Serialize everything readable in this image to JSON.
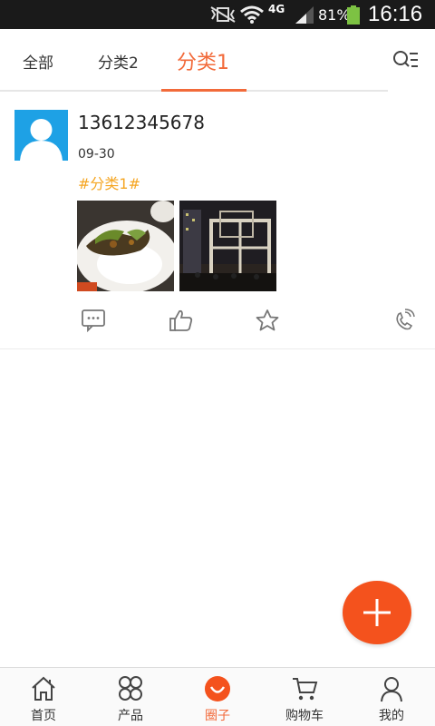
{
  "status_bar": {
    "network_type": "4G",
    "battery_percent": "81%",
    "time": "16:16"
  },
  "tabs": [
    {
      "label": "全部",
      "active": false
    },
    {
      "label": "分类2",
      "active": false
    },
    {
      "label": "分类1",
      "active": true
    }
  ],
  "filter_icon": "search-filter-icon",
  "post": {
    "username": "13612345678",
    "date": "09-30",
    "tag": "#分类1#",
    "photos": [
      "food-photo",
      "night-building-photo"
    ],
    "actions": [
      "comment-icon",
      "like-icon",
      "favorite-icon",
      "phone-icon"
    ]
  },
  "fab": {
    "icon": "plus-icon"
  },
  "bottom_nav": [
    {
      "label": "首页",
      "icon": "home-icon",
      "active": false
    },
    {
      "label": "产品",
      "icon": "products-icon",
      "active": false
    },
    {
      "label": "圈子",
      "icon": "circle-icon",
      "active": true
    },
    {
      "label": "购物车",
      "icon": "cart-icon",
      "active": false
    },
    {
      "label": "我的",
      "icon": "user-icon",
      "active": false
    }
  ],
  "colors": {
    "accent": "#f26a3a",
    "fab": "#f4521d",
    "tag": "#f5a623",
    "avatar_bg": "#1ea1e5",
    "status_bar": "#1a1a1a"
  }
}
